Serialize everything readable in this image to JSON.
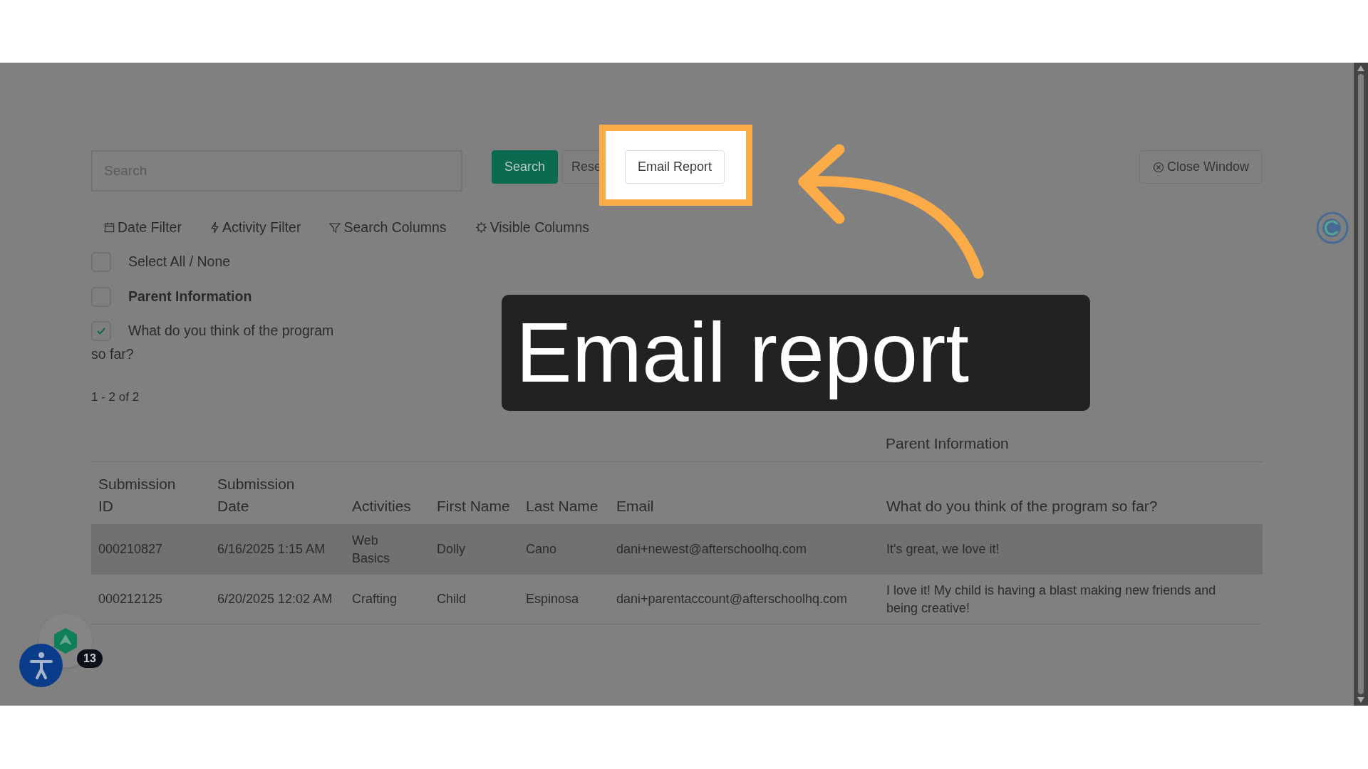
{
  "toolbar": {
    "search": {
      "placeholder": "Search"
    },
    "buttons": [
      {
        "label": "Search",
        "kind": "primary",
        "highlighted": false
      },
      {
        "label": "Rese",
        "kind": "plain",
        "highlighted": false
      },
      {
        "label": "Email Report",
        "kind": "plain",
        "highlighted": true
      }
    ],
    "close_button": "Close Window"
  },
  "filters": [
    {
      "label": "Date Filter",
      "kind": "calendar"
    },
    {
      "label": "Activity Filter",
      "kind": "bolt"
    },
    {
      "label": "Search Columns",
      "kind": "funnel"
    },
    {
      "label": "Visible Columns",
      "kind": "gear"
    }
  ],
  "column_options": [
    {
      "label": "Select All / None",
      "checked": false,
      "bold": false
    },
    {
      "label": "Parent Information",
      "checked": false,
      "bold": true
    },
    {
      "label": "What do you think of the program",
      "continuation": "so far?",
      "checked": true,
      "bold": false
    }
  ],
  "pagination": "1 - 2 of 2",
  "table": {
    "group_header": "Parent Information",
    "columns": [
      "Submission ID",
      "Submission Date",
      "Activities",
      "First Name",
      "Last Name",
      "Email",
      "What do you think of the program so far?"
    ],
    "rows": [
      {
        "cells": [
          "000210827",
          "6/16/2025 1:15 AM",
          "Web Basics",
          "Dolly",
          "Cano",
          "dani+newest@afterschoolhq.com",
          "It's great, we love it!"
        ],
        "selected": true
      },
      {
        "cells": [
          "000212125",
          "6/20/2025 12:02 AM",
          "Crafting",
          "Child",
          "Espinosa",
          "dani+parentaccount@afterschoolhq.com",
          "I love it! My child is having a blast making new friends and being creative!"
        ],
        "selected": false
      }
    ]
  },
  "notification_badge": "13",
  "caption": "Email report"
}
